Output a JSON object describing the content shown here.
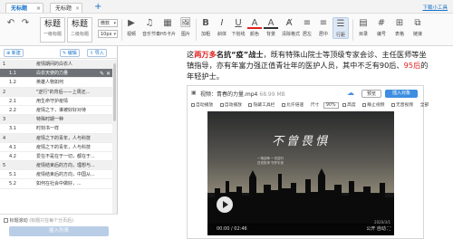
{
  "tabs": [
    {
      "label": "无标题",
      "close": "×"
    },
    {
      "label": "无标题",
      "close": "×"
    }
  ],
  "tab_add": "+",
  "toolbox_link": "下载小工具",
  "toolbar": {
    "undo": "↶",
    "redo": "↷",
    "style_title": {
      "big": "标题",
      "small": "一级标题"
    },
    "style_body": {
      "big": "标题",
      "small": "二级标题"
    },
    "font_select": "微软",
    "size_select": "10px",
    "buttons": [
      {
        "icon": "▶",
        "label": "视频"
      },
      {
        "icon": "♫",
        "label": "音乐节奏"
      },
      {
        "icon": "▦",
        "label": "H5卡片"
      },
      {
        "icon": "🖼",
        "label": "图片"
      },
      {
        "icon": "B",
        "label": "加粗"
      },
      {
        "icon": "I",
        "label": "斜体"
      },
      {
        "icon": "U",
        "label": "下划线"
      },
      {
        "icon": "A",
        "label": "颜色"
      },
      {
        "icon": "A",
        "label": "背景"
      },
      {
        "icon": "Ⱥ",
        "label": "清除格式"
      },
      {
        "icon": "≡",
        "label": "居左"
      },
      {
        "icon": "≡",
        "label": "居中"
      },
      {
        "icon": "☰",
        "label": "行距"
      },
      {
        "icon": "▤",
        "label": "目录"
      },
      {
        "icon": "#",
        "label": "编号"
      },
      {
        "icon": "⊞",
        "label": "表格"
      },
      {
        "icon": "⧉",
        "label": "链接"
      }
    ]
  },
  "left_panel": {
    "btn_new": "新建",
    "btn_edit": "编辑",
    "btn_import": "导入",
    "rows": [
      {
        "num": "1",
        "text": "疫情期间的白衣人",
        "group": true
      },
      {
        "num": "1.1",
        "text": "白衣天使的力量",
        "selected": true
      },
      {
        "num": "1.2",
        "text": "英雄人物如何",
        "group": false
      },
      {
        "num": "2",
        "text": "\"逆行\"的背后——上周还...",
        "group": true
      },
      {
        "num": "2.1",
        "text": "用生命守护疫情",
        "group": false
      },
      {
        "num": "2.2",
        "text": "疫情之下，谁被好好对待",
        "group": false
      },
      {
        "num": "3",
        "text": "特殊时期一种",
        "group": true
      },
      {
        "num": "3.1",
        "text": "时刻书一样",
        "group": false
      },
      {
        "num": "4",
        "text": "疫情之下的青年，人与科技",
        "group": true
      },
      {
        "num": "4.1",
        "text": "疫情之下的青年，人与科技",
        "group": false
      },
      {
        "num": "4.2",
        "text": "爱在不是在于一切，都在于...",
        "group": false
      },
      {
        "num": "5",
        "text": "疫情结束后的方向，理想与...",
        "group": true
      },
      {
        "num": "5.1",
        "text": "疫情结束后的方向，中国从...",
        "group": false
      },
      {
        "num": "5.2",
        "text": "如何在社会中做好，...",
        "group": false
      }
    ],
    "footer_check_label": "标题滚动",
    "footer_hint": "(标题只在每个分页后)",
    "footer_button": "插入列表"
  },
  "editor": {
    "para": {
      "p1": "这",
      "p2": "两万多",
      "p3": "名抗",
      "p4": "“疫”",
      "p5": "战士",
      "p6": "，既有特殊山院士等顶级专家会诊、主任医师等坐镇指导，亦有年富力强正值青壮年的医护人员，其中不乏有90后、",
      "p7": "95后",
      "p8": "的年轻护士。"
    },
    "video": {
      "filename": "视频：青春的力量.mp4",
      "size": "68.99 MB",
      "preview": "预览",
      "insert": "插入对象",
      "options": [
        "自动播放",
        "自动播放",
        "隐藏工具栏",
        "允许倍速",
        "尺寸",
        "90%",
        "高度",
        "静止视频",
        "无音视频",
        "全部"
      ],
      "overlay_title": "不曾畏惧",
      "overlay_sub": "一场战争 一次逆行\n白衣执甲 守护平安",
      "time": "00:00 / 02:46",
      "right_ctrl": "公开 自动 ⛶",
      "watermark": "2020/3/1"
    }
  }
}
